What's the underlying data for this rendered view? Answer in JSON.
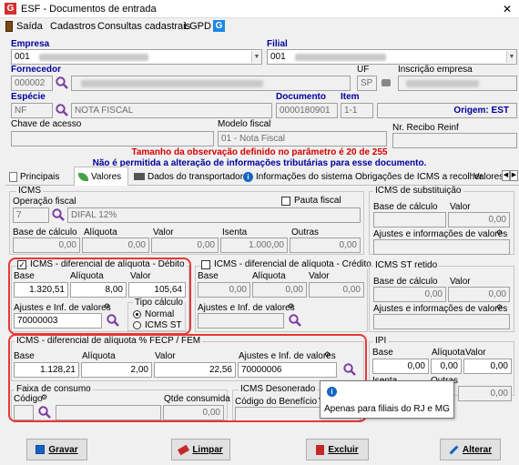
{
  "window": {
    "title": "ESF - Documentos de entrada",
    "close": "✕"
  },
  "menu": [
    "Saída",
    "Cadastros",
    "Consultas cadastrais",
    "LGPD"
  ],
  "header": {
    "empresa_label": "Empresa",
    "empresa_value": "001",
    "filial_label": "Filial",
    "filial_value": "001",
    "fornecedor_label": "Fornecedor",
    "fornecedor_value": "000002",
    "uf_label": "UF",
    "uf_value": "SP",
    "inscricao_label": "Inscrição empresa",
    "especie_label": "Espécie",
    "especie_code": "NF",
    "especie_desc": "NOTA FISCAL",
    "documento_label": "Documento",
    "documento_value": "0000180901",
    "item_label": "Item",
    "item_value": "1-1",
    "origem": "Origem: EST",
    "chave_label": "Chave de acesso",
    "modelo_label": "Modelo fiscal",
    "modelo_value": "01 - Nota Fiscal",
    "recibo_label": "Nr. Recibo Reinf"
  },
  "notices": [
    "Tamanho da observação definido no parâmetro é 20 de 255",
    "Não é permitida a alteração de informações tributárias para esse documento."
  ],
  "tabs": [
    "Principais",
    "Valores",
    "Dados do transportador",
    "Informações do sistema",
    "Obrigações de ICMS a recolher",
    "Valores"
  ],
  "icms": {
    "title": "ICMS",
    "operacao_label": "Operação fiscal",
    "operacao_code": "7",
    "operacao_desc": "DIFAL 12%",
    "pauta_label": "Pauta fiscal",
    "base_label": "Base de cálculo",
    "aliquota_label": "Alíquota",
    "valor_label": "Valor",
    "isenta_label": "Isenta",
    "outras_label": "Outras",
    "base": "0,00",
    "aliquota": "0,00",
    "valor": "0,00",
    "isenta": "1.000,00",
    "outras": "0,00"
  },
  "icms_sub": {
    "title": "ICMS de substituição",
    "base_label": "Base de cálculo",
    "valor_label": "Valor",
    "valor": "0,00",
    "ajustes_label": "Ajustes e informações de valores"
  },
  "difal_debito": {
    "title": "ICMS - diferencial de alíquota - Débito",
    "base_label": "Base",
    "aliquota_label": "Alíquota",
    "valor_label": "Valor",
    "base": "1.320,51",
    "aliquota": "8,00",
    "valor": "105,64",
    "ajustes_label": "Ajustes e Inf. de valores",
    "ajustes_value": "70000003",
    "tipo_label": "Tipo cálculo",
    "normal": "Normal",
    "icms_st": "ICMS ST"
  },
  "difal_credito": {
    "title": "ICMS - diferencial de alíquota - Crédito",
    "base_label": "Base",
    "aliquota_label": "Alíquota",
    "valor_label": "Valor",
    "base": "0,00",
    "aliquota": "0,00",
    "valor": "0,00",
    "ajustes_label": "Ajustes e Inf. de valores"
  },
  "st_retido": {
    "title": "ICMS ST retido",
    "base_label": "Base de cálculo",
    "valor_label": "Valor",
    "base": "0,00",
    "valor": "0,00",
    "ajustes_label": "Ajustes e informações de valores"
  },
  "fecp": {
    "title": "ICMS - diferencial de alíquota % FECP / FEM",
    "base_label": "Base",
    "aliquota_label": "Alíquota",
    "valor_label": "Valor",
    "ajustes_label": "Ajustes e Inf. de valores",
    "base": "1.128,21",
    "aliquota": "2,00",
    "valor": "22,56",
    "ajustes_value": "70000006"
  },
  "ipi": {
    "title": "IPI",
    "base_label": "Base",
    "aliquota_label": "Alíquota",
    "valor_label": "Valor",
    "base": "0,00",
    "aliquota": "0,00",
    "valor": "0,00",
    "isenta_label": "Isenta",
    "outras_label": "Outras",
    "outras": "0,00"
  },
  "faixa": {
    "title": "Faixa de consumo",
    "codigo_label": "Código",
    "qtde_label": "Qtde consumida",
    "qtde": "0,00"
  },
  "desonerado": {
    "title": "ICMS Desonerado",
    "codigo_label": "Código do Benefício",
    "va_label": "Va"
  },
  "tooltip": {
    "text": "Apenas para filiais do RJ e MG"
  },
  "buttons": {
    "gravar": "Gravar",
    "limpar": "Limpar",
    "excluir": "Excluir",
    "alterar": "Alterar"
  }
}
